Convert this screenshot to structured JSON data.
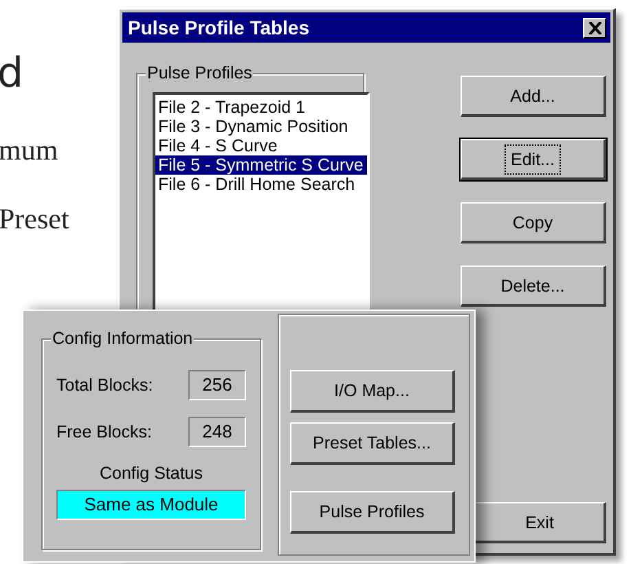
{
  "document": {
    "heading": "d",
    "lines": [
      "mum",
      "Preset"
    ]
  },
  "dialog": {
    "title": "Pulse Profile Tables",
    "group_label": "Pulse Profiles",
    "profiles": [
      {
        "label": "File 2 - Trapezoid 1",
        "selected": false
      },
      {
        "label": "File 3 - Dynamic Position",
        "selected": false
      },
      {
        "label": "File 4 - S Curve",
        "selected": false
      },
      {
        "label": "File 5 - Symmetric S Curve",
        "selected": true
      },
      {
        "label": "File 6 - Drill Home Search",
        "selected": false
      }
    ],
    "buttons": [
      {
        "label": "Add...",
        "focused": false
      },
      {
        "label": "Edit...",
        "focused": true
      },
      {
        "label": "Copy",
        "focused": false
      },
      {
        "label": "Delete...",
        "focused": false
      }
    ],
    "exit_button": "Exit"
  },
  "config_panel": {
    "group_label": "Config Information",
    "fields": [
      {
        "label": "Total Blocks:",
        "value": "256"
      },
      {
        "label": "Free Blocks:",
        "value": "248"
      }
    ],
    "status_label": "Config Status",
    "status": "Same as Module",
    "buttons": [
      "I/O Map...",
      "Preset Tables...",
      "Pulse Profiles"
    ]
  }
}
